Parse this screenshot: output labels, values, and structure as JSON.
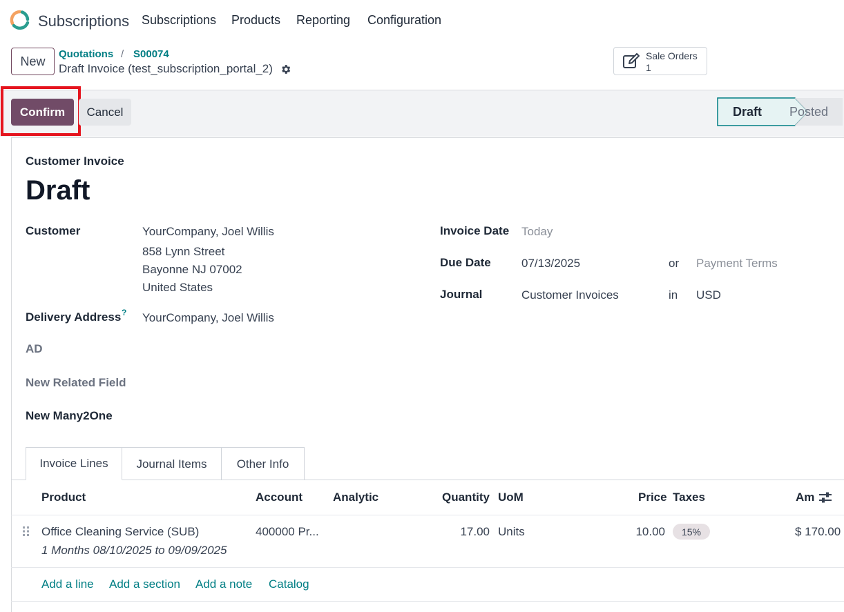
{
  "topnav": {
    "app_title": "Subscriptions",
    "menu": [
      "Subscriptions",
      "Products",
      "Reporting",
      "Configuration"
    ]
  },
  "control_panel": {
    "new_label": "New",
    "breadcrumb": [
      "Quotations",
      "S00074"
    ],
    "breadcrumb_sep": "/",
    "record_name": "Draft Invoice (test_subscription_portal_2)",
    "smart_button": {
      "label": "Sale Orders",
      "value": "1"
    }
  },
  "actions": {
    "confirm": "Confirm",
    "cancel": "Cancel"
  },
  "status": {
    "stages": [
      "Draft",
      "Posted"
    ],
    "current": "Draft"
  },
  "form": {
    "subtitle": "Customer Invoice",
    "title": "Draft",
    "customer_label": "Customer",
    "customer_lines": [
      "YourCompany, Joel Willis",
      "858 Lynn Street",
      "Bayonne NJ 07002",
      "United States"
    ],
    "delivery_label": "Delivery Address",
    "delivery_help": "?",
    "delivery_value": "YourCompany, Joel Willis",
    "ad_label": "AD",
    "related_label": "New Related Field",
    "many2one_label": "New Many2One",
    "invoice_date_label": "Invoice Date",
    "invoice_date_placeholder": "Today",
    "due_date_label": "Due Date",
    "due_date_value": "07/13/2025",
    "or_text": "or",
    "payment_terms_placeholder": "Payment Terms",
    "journal_label": "Journal",
    "journal_value": "Customer Invoices",
    "in_text": "in",
    "currency_value": "USD"
  },
  "tabs": [
    "Invoice Lines",
    "Journal Items",
    "Other Info"
  ],
  "lines_table": {
    "columns": [
      "Product",
      "Account",
      "Analytic",
      "Quantity",
      "UoM",
      "Price",
      "Taxes",
      "Am"
    ],
    "rows": [
      {
        "product": "Office Cleaning Service (SUB)",
        "description": "1 Months 08/10/2025 to 09/09/2025",
        "account": "400000 Pr...",
        "analytic": "",
        "quantity": "17.00",
        "uom": "Units",
        "price": "10.00",
        "tax": "15%",
        "amount": "$ 170.00"
      }
    ],
    "add_links": [
      "Add a line",
      "Add a section",
      "Add a note",
      "Catalog"
    ]
  },
  "colors": {
    "primary": "#714b67",
    "link": "#017e84",
    "highlight": "#e5141e"
  }
}
